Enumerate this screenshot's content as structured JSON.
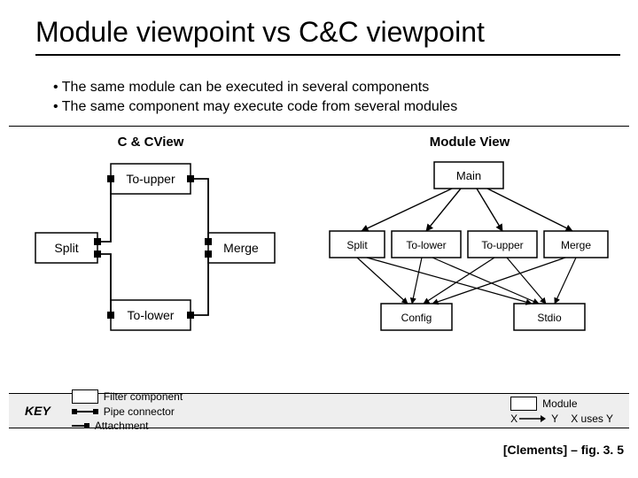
{
  "title": "Module viewpoint vs C&C viewpoint",
  "bullets": [
    "The same module can be executed in several components",
    "The same component may execute code from several modules"
  ],
  "views": {
    "left_title": "C  &  CView",
    "right_title": "Module View"
  },
  "cc_boxes": {
    "to_upper": "To-upper",
    "split": "Split",
    "merge": "Merge",
    "to_lower": "To-lower"
  },
  "module_boxes": {
    "main": "Main",
    "split": "Split",
    "to_lower": "To-lower",
    "to_upper": "To-upper",
    "merge": "Merge",
    "config": "Config",
    "stdio": "Stdio"
  },
  "key": {
    "label": "KEY",
    "filter": "Filter component",
    "pipe": "Pipe connector",
    "attach": "Attachment",
    "module": "Module",
    "x": "X",
    "y": "Y",
    "uses": "X uses Y"
  },
  "citation": "[Clements] – fig. 3. 5"
}
